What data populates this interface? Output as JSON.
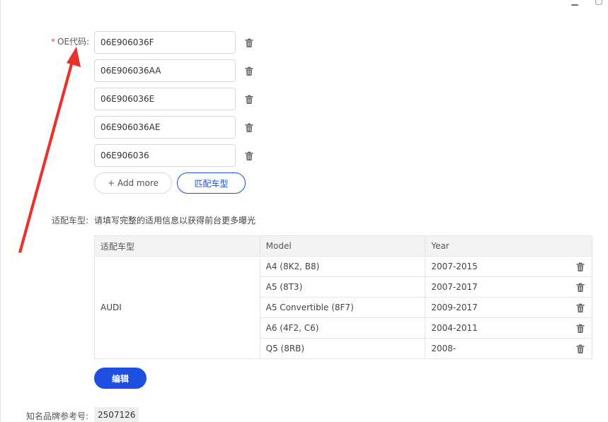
{
  "window": {
    "controls": [
      "minimize",
      "maximize"
    ]
  },
  "oe_section": {
    "label": "OE代码:",
    "required_mark": "*",
    "codes": [
      "06E906036F",
      "06E906036AA",
      "06E906036E",
      "06E906036AE",
      "06E906036"
    ],
    "add_more_label": "+ Add more",
    "match_label": "匹配车型"
  },
  "fitment": {
    "label": "适配车型:",
    "hint": "请填写完整的适用信息以获得前台更多曝光",
    "columns": [
      "适配车型",
      "Model",
      "Year"
    ],
    "brand": "AUDI",
    "rows": [
      {
        "model": "A4 (8K2, B8)",
        "year": "2007-2015"
      },
      {
        "model": "A5 (8T3)",
        "year": "2007-2017"
      },
      {
        "model": "A5 Convertible (8F7)",
        "year": "2009-2017"
      },
      {
        "model": "A6 (4F2, C6)",
        "year": "2004-2011"
      },
      {
        "model": "Q5 (8RB)",
        "year": "2008-"
      }
    ],
    "edit_label": "编辑"
  },
  "brand_ref": {
    "label": "知名品牌参考号:",
    "value": "2507126"
  },
  "colors": {
    "accent": "#1e4fe0",
    "required": "#e83b3b",
    "annotation_arrow": "#e8322b"
  }
}
